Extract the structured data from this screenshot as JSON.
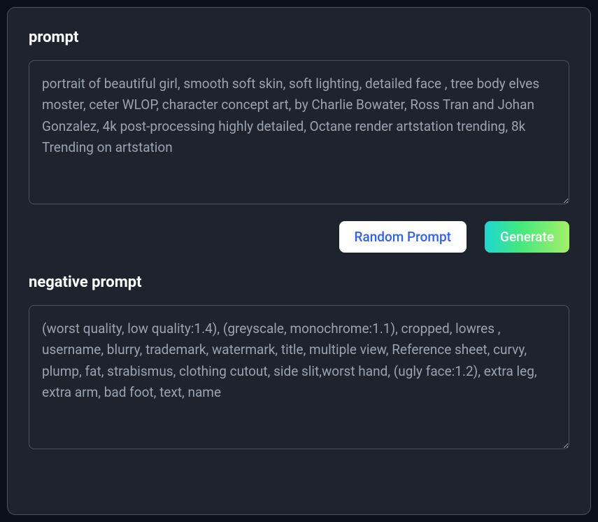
{
  "prompt": {
    "label": "prompt",
    "value": "portrait of beautiful girl, smooth soft skin, soft lighting, detailed face , tree body elves moster, ceter WLOP, character concept art, by Charlie Bowater, Ross Tran and Johan Gonzalez, 4k post-processing highly detailed, Octane render artstation trending, 8k Trending on artstation"
  },
  "buttons": {
    "random": "Random Prompt",
    "generate": "Generate"
  },
  "negative_prompt": {
    "label": "negative prompt",
    "value": "(worst quality, low quality:1.4), (greyscale, monochrome:1.1), cropped, lowres , username, blurry, trademark, watermark, title, multiple view, Reference sheet, curvy, plump, fat, strabismus, clothing cutout, side slit,worst hand, (ugly face:1.2), extra leg, extra arm, bad foot, text, name"
  }
}
